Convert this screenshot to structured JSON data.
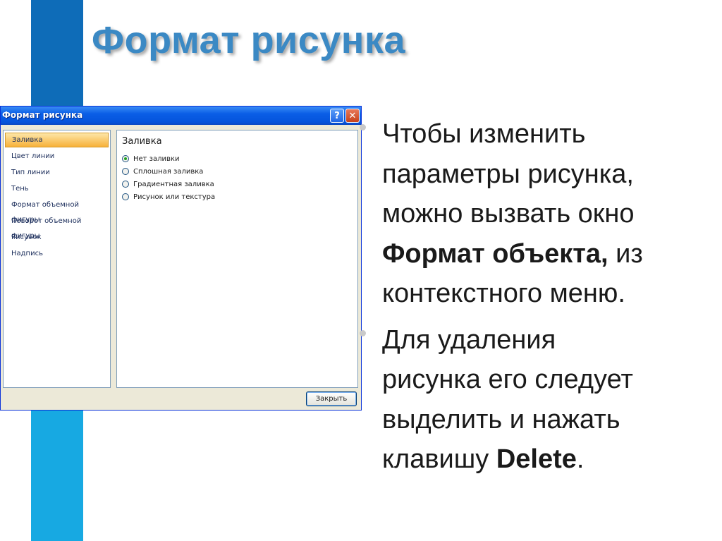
{
  "slide": {
    "title": "Формат рисунка"
  },
  "dialog": {
    "title": "Формат рисунка",
    "help_glyph": "?",
    "close_glyph": "✕",
    "nav_items": [
      "Заливка",
      "Цвет линии",
      "Тип линии",
      "Тень",
      "Формат объемной фигуры",
      "Поворот объемной фигуры",
      "Рисунок",
      "Надпись"
    ],
    "selected_nav": "Заливка",
    "section_heading": "Заливка",
    "fill_options": [
      {
        "label": "Нет заливки",
        "checked": true
      },
      {
        "label": "Сплошная заливка",
        "checked": false
      },
      {
        "label": "Градиентная заливка",
        "checked": false
      },
      {
        "label": "Рисунок или текстура",
        "checked": false
      }
    ],
    "close_button_label": "Закрыть"
  },
  "bullets": {
    "b1_part1": "Чтобы изменить",
    "b1_part2": "параметры рисунка,",
    "b1_part3": "можно вызвать окно",
    "b1_bold": "Формат объекта,",
    "b1_after_bold": " из",
    "b1_part4": "контекстного меню.",
    "b2_part1": "Для удаления",
    "b2_part2": "рисунка его следует",
    "b2_part3": "выделить и нажать",
    "b2_pre_bold": "клавишу ",
    "b2_bold": "Delete",
    "b2_after_bold": "."
  },
  "colors": {
    "stripe_dark": "#0e6cb8",
    "stripe_light": "#17a9e2",
    "title_color": "#3b89c4",
    "titlebar_blue": "#0554dc",
    "selected_item": "#f7b13a"
  },
  "icons": {
    "help": "help-icon",
    "close": "close-icon",
    "bullet": "bullet-dot-icon",
    "radio": "radio-button-icon"
  }
}
